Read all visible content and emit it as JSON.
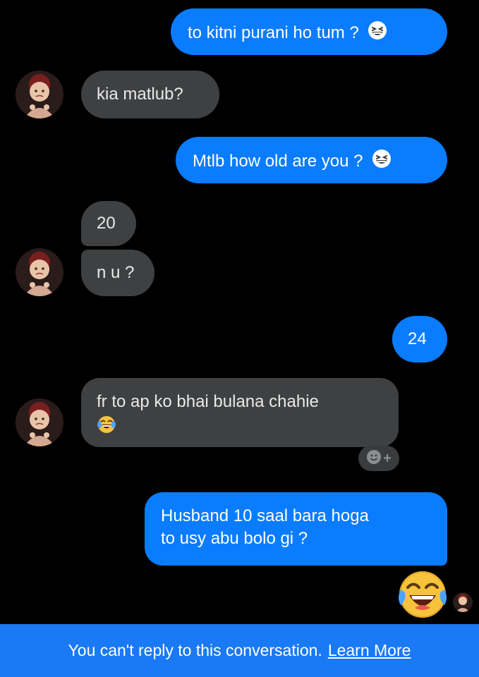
{
  "messages": {
    "m1": {
      "text": "to kitni purani ho tum ?",
      "emoji": "grinning-squint-icon"
    },
    "m2": {
      "text": "kia matlub?"
    },
    "m3": {
      "text": "Mtlb how old are you ?",
      "emoji": "grinning-squint-icon"
    },
    "m4": {
      "text": "20"
    },
    "m5": {
      "text": "n u ?"
    },
    "m6": {
      "text": "24"
    },
    "m7": {
      "line1": "fr to ap ko bhai bulana chahie",
      "emoji": "tears-of-joy-icon"
    },
    "m8": {
      "line1": "Husband 10 saal bara hoga",
      "line2": "to usy abu bolo gi ?"
    },
    "m9": {
      "emoji": "tears-of-joy-icon"
    }
  },
  "reaction_pill": {
    "icon": "add-reaction-icon",
    "plus": "+"
  },
  "footer": {
    "notice": "You can't reply to this conversation.",
    "link": "Learn More"
  },
  "colors": {
    "outgoing_bubble": "#0a7cff",
    "incoming_bubble": "#3e4042",
    "footer_bar": "#1a79f5",
    "background": "#000000"
  }
}
